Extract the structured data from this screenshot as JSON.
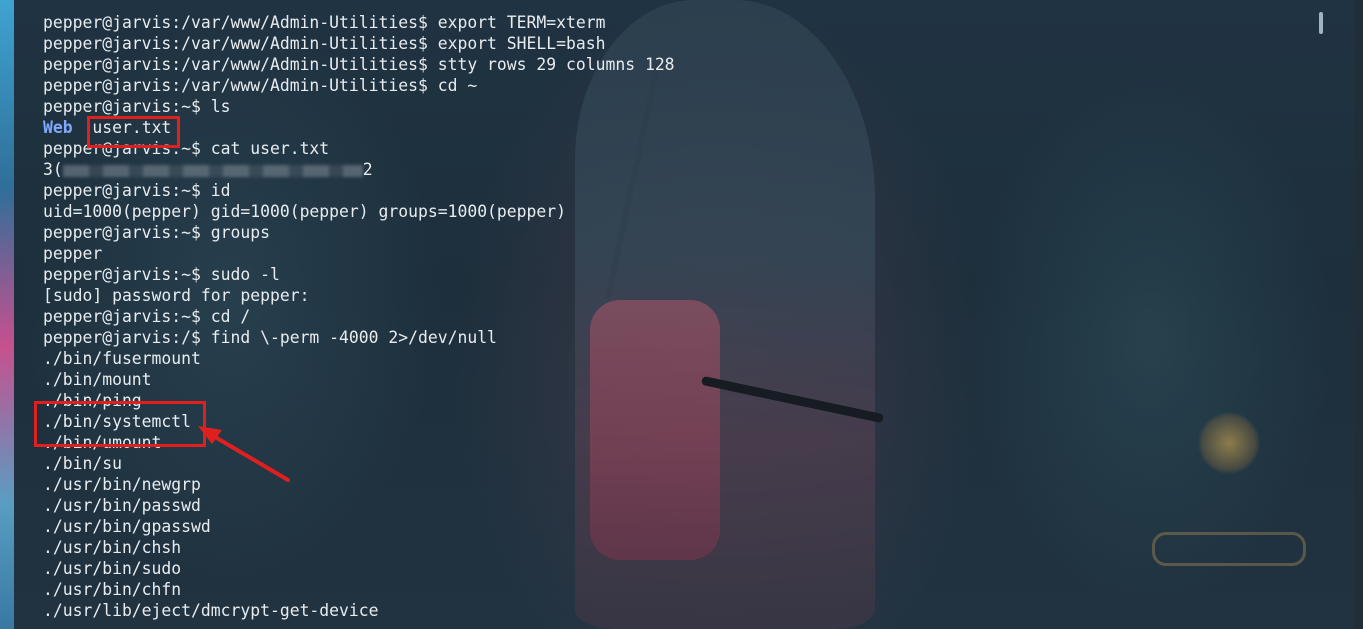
{
  "terminal": {
    "lines": [
      "pepper@jarvis:/var/www/Admin-Utilities$ export TERM=xterm",
      "pepper@jarvis:/var/www/Admin-Utilities$ export SHELL=bash",
      "pepper@jarvis:/var/www/Admin-Utilities$ stty rows 29 columns 128",
      "pepper@jarvis:/var/www/Admin-Utilities$ cd ~",
      "pepper@jarvis:~$ ls"
    ],
    "ls_output": {
      "dir": "Web",
      "file": "user.txt"
    },
    "lines2": [
      "pepper@jarvis:~$ cat user.txt"
    ],
    "hash_line": {
      "start": "3(",
      "end": "2"
    },
    "lines3": [
      "pepper@jarvis:~$ id",
      "uid=1000(pepper) gid=1000(pepper) groups=1000(pepper)",
      "pepper@jarvis:~$ groups",
      "pepper",
      "pepper@jarvis:~$ sudo -l",
      "[sudo] password for pepper:",
      "pepper@jarvis:~$ cd /",
      "pepper@jarvis:/$ find \\-perm -4000 2>/dev/null",
      "./bin/fusermount",
      "./bin/mount",
      "./bin/ping",
      "./bin/systemctl",
      "./bin/umount",
      "./bin/su",
      "./usr/bin/newgrp",
      "./usr/bin/passwd",
      "./usr/bin/gpasswd",
      "./usr/bin/chsh",
      "./usr/bin/sudo",
      "./usr/bin/chfn",
      "./usr/lib/eject/dmcrypt-get-device"
    ]
  },
  "colors": {
    "text": "#e8ecef",
    "directory": "#80a9ff",
    "highlight": "#e0201e"
  }
}
